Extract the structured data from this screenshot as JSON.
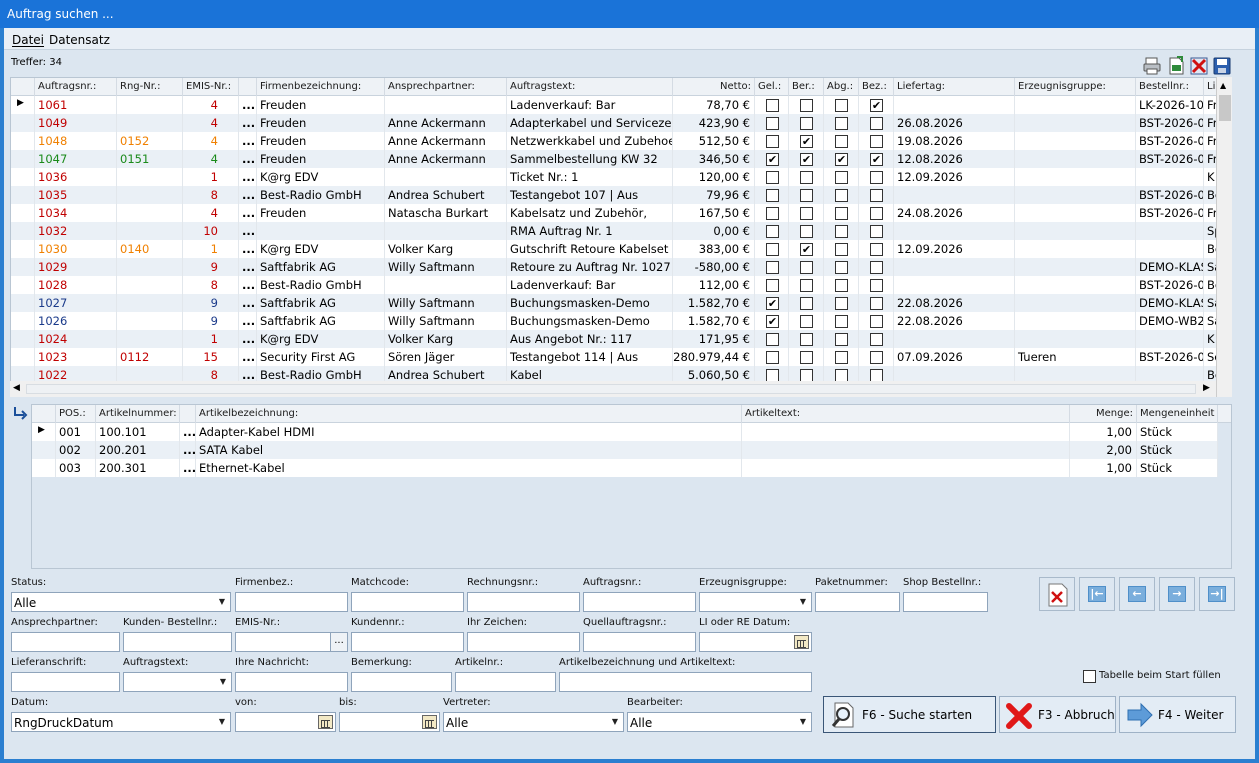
{
  "window": {
    "title": "Auftrag suchen ..."
  },
  "menu": [
    "Datei",
    "Datensatz"
  ],
  "hits": "Treffer: 34",
  "toolbar_icons": [
    "print-icon",
    "export-excel-icon",
    "delete-icon",
    "save-icon"
  ],
  "orders": {
    "headers": [
      "Auftragsnr.:",
      "Rng-Nr.:",
      "EMIS-Nr.:",
      "",
      "Firmenbezeichnung:",
      "Ansprechpartner:",
      "Auftragstext:",
      "Netto:",
      "Gel.:",
      "Ber.:",
      "Abg.:",
      "Bez.:",
      "Liefertag:",
      "Erzeugnisgruppe:",
      "Bestellnr.:",
      "Li"
    ],
    "rows": [
      {
        "nr": "1061",
        "rng": "",
        "emis": "4",
        "dots": "...",
        "firma": "Freuden",
        "ansp": "",
        "text": "Ladenverkauf: Bar",
        "netto": "78,70 €",
        "gel": false,
        "ber": false,
        "abg": false,
        "bez": true,
        "liefertag": "",
        "gruppe": "",
        "bestell": "LK-2026-10",
        "li": "Fr",
        "color": "#c00000",
        "current": true
      },
      {
        "nr": "1049",
        "rng": "",
        "emis": "4",
        "dots": "...",
        "firma": "Freuden",
        "ansp": "Anne Ackermann",
        "text": "Adapterkabel und Servicezeit",
        "netto": "423,90 €",
        "gel": false,
        "ber": false,
        "abg": false,
        "bez": false,
        "liefertag": "26.08.2026",
        "gruppe": "",
        "bestell": "BST-2026-0",
        "li": "Fr",
        "color": "#c00000"
      },
      {
        "nr": "1048",
        "rng": "0152",
        "emis": "4",
        "dots": "...",
        "firma": "Freuden",
        "ansp": "Anne Ackermann",
        "text": "Netzwerkkabel und Zubehoer",
        "netto": "512,50 €",
        "gel": false,
        "ber": true,
        "abg": false,
        "bez": false,
        "liefertag": "19.08.2026",
        "gruppe": "",
        "bestell": "BST-2026-0",
        "li": "Fr",
        "color": "#f08000"
      },
      {
        "nr": "1047",
        "rng": "0151",
        "emis": "4",
        "dots": "...",
        "firma": "Freuden",
        "ansp": "Anne Ackermann",
        "text": "Sammelbestellung KW 32",
        "netto": "346,50 €",
        "gel": true,
        "ber": true,
        "abg": true,
        "bez": true,
        "liefertag": "12.08.2026",
        "gruppe": "",
        "bestell": "BST-2026-0",
        "li": "Fr",
        "color": "#1a8a1a"
      },
      {
        "nr": "1036",
        "rng": "",
        "emis": "1",
        "dots": "...",
        "firma": "K@rg EDV",
        "ansp": "",
        "text": "Ticket Nr.: 1",
        "netto": "120,00 €",
        "gel": false,
        "ber": false,
        "abg": false,
        "bez": false,
        "liefertag": "12.09.2026",
        "gruppe": "",
        "bestell": "",
        "li": "K",
        "color": "#c00000"
      },
      {
        "nr": "1035",
        "rng": "",
        "emis": "8",
        "dots": "...",
        "firma": "Best-Radio GmbH",
        "ansp": "Andrea Schubert",
        "text": "Testangebot 107 | Aus",
        "netto": "79,96 €",
        "gel": false,
        "ber": false,
        "abg": false,
        "bez": false,
        "liefertag": "",
        "gruppe": "",
        "bestell": "BST-2026-0",
        "li": "Be",
        "color": "#c00000"
      },
      {
        "nr": "1034",
        "rng": "",
        "emis": "4",
        "dots": "...",
        "firma": "Freuden",
        "ansp": "Natascha Burkart",
        "text": "Kabelsatz und Zubehör,",
        "netto": "167,50 €",
        "gel": false,
        "ber": false,
        "abg": false,
        "bez": false,
        "liefertag": "24.08.2026",
        "gruppe": "",
        "bestell": "BST-2026-0",
        "li": "Fr",
        "color": "#c00000"
      },
      {
        "nr": "1032",
        "rng": "",
        "emis": "10",
        "dots": "...",
        "firma": "",
        "ansp": "",
        "text": "RMA Auftrag Nr. 1",
        "netto": "0,00 €",
        "gel": false,
        "ber": false,
        "abg": false,
        "bez": false,
        "liefertag": "",
        "gruppe": "",
        "bestell": "",
        "li": "Sp",
        "color": "#c00000"
      },
      {
        "nr": "1030",
        "rng": "0140",
        "emis": "1",
        "dots": "...",
        "firma": "K@rg EDV",
        "ansp": "Volker Karg",
        "text": "Gutschrift Retoure Kabelset",
        "netto": "383,00 €",
        "gel": false,
        "ber": true,
        "abg": false,
        "bez": false,
        "liefertag": "12.09.2026",
        "gruppe": "",
        "bestell": "",
        "li": "Be",
        "color": "#f08000"
      },
      {
        "nr": "1029",
        "rng": "",
        "emis": "9",
        "dots": "...",
        "firma": "Saftfabrik AG",
        "ansp": "Willy Saftmann",
        "text": "Retoure zu Auftrag Nr. 1027",
        "netto": "-580,00 €",
        "gel": false,
        "ber": false,
        "abg": false,
        "bez": false,
        "liefertag": "",
        "gruppe": "",
        "bestell": "DEMO-KLAS",
        "li": "Sa",
        "color": "#c00000"
      },
      {
        "nr": "1028",
        "rng": "",
        "emis": "8",
        "dots": "...",
        "firma": "Best-Radio GmbH",
        "ansp": "",
        "text": "Ladenverkauf: Bar",
        "netto": "112,00 €",
        "gel": false,
        "ber": false,
        "abg": false,
        "bez": false,
        "liefertag": "",
        "gruppe": "",
        "bestell": "BST-2026-0",
        "li": "Be",
        "color": "#c00000"
      },
      {
        "nr": "1027",
        "rng": "",
        "emis": "9",
        "dots": "...",
        "firma": "Saftfabrik AG",
        "ansp": "Willy Saftmann",
        "text": "Buchungsmasken-Demo",
        "netto": "1.582,70 €",
        "gel": true,
        "ber": false,
        "abg": false,
        "bez": false,
        "liefertag": "22.08.2026",
        "gruppe": "",
        "bestell": "DEMO-KLAS",
        "li": "Sa",
        "color": "#1a3a8a"
      },
      {
        "nr": "1026",
        "rng": "",
        "emis": "9",
        "dots": "...",
        "firma": "Saftfabrik AG",
        "ansp": "Willy Saftmann",
        "text": "Buchungsmasken-Demo",
        "netto": "1.582,70 €",
        "gel": true,
        "ber": false,
        "abg": false,
        "bez": false,
        "liefertag": "22.08.2026",
        "gruppe": "",
        "bestell": "DEMO-WB2",
        "li": "Sa",
        "color": "#1a3a8a"
      },
      {
        "nr": "1024",
        "rng": "",
        "emis": "1",
        "dots": "...",
        "firma": "K@rg EDV",
        "ansp": "Volker Karg",
        "text": "Aus Angebot Nr.: 117",
        "netto": "171,95 €",
        "gel": false,
        "ber": false,
        "abg": false,
        "bez": false,
        "liefertag": "",
        "gruppe": "",
        "bestell": "",
        "li": "K",
        "color": "#c00000"
      },
      {
        "nr": "1023",
        "rng": "0112",
        "emis": "15",
        "dots": "...",
        "firma": "Security First AG",
        "ansp": "Sören Jäger",
        "text": "Testangebot 114 | Aus",
        "netto": "280.979,44 €",
        "gel": false,
        "ber": false,
        "abg": false,
        "bez": false,
        "liefertag": "07.09.2026",
        "gruppe": "Tueren",
        "bestell": "BST-2026-0",
        "li": "Se",
        "color": "#c00000"
      },
      {
        "nr": "1022",
        "rng": "",
        "emis": "8",
        "dots": "...",
        "firma": "Best-Radio GmbH",
        "ansp": "Andrea Schubert",
        "text": "Kabel",
        "netto": "5.060,50 €",
        "gel": false,
        "ber": false,
        "abg": false,
        "bez": false,
        "liefertag": "",
        "gruppe": "",
        "bestell": "",
        "li": "Be",
        "color": "#c00000"
      }
    ]
  },
  "positions": {
    "headers": [
      "POS.:",
      "Artikelnummer:",
      "",
      "Artikelbezeichnung:",
      "Artikeltext:",
      "Menge:",
      "Mengeneinheit"
    ],
    "rows": [
      {
        "pos": "001",
        "art": "100.101",
        "dots": "...",
        "bez": "Adapter-Kabel HDMI",
        "text": "",
        "menge": "1,00",
        "einheit": "Stück",
        "current": true
      },
      {
        "pos": "002",
        "art": "200.201",
        "dots": "...",
        "bez": "SATA Kabel",
        "text": "",
        "menge": "2,00",
        "einheit": "Stück"
      },
      {
        "pos": "003",
        "art": "200.301",
        "dots": "...",
        "bez": "Ethernet-Kabel",
        "text": "",
        "menge": "1,00",
        "einheit": "Stück"
      }
    ]
  },
  "filters": {
    "status_label": "Status:",
    "status_value": "Alle",
    "firmenbez_label": "Firmenbez.:",
    "matchcode_label": "Matchcode:",
    "rechnungsnr_label": "Rechnungsnr.:",
    "auftragsnr_label": "Auftragsnr.:",
    "erzeugnisgruppe_label": "Erzeugnisgruppe:",
    "paketnummer_label": "Paketnummer:",
    "shop_label": "Shop Bestellnr.:",
    "ansprechpartner_label": "Ansprechpartner:",
    "kundenbestell_label": "Kunden- Bestellnr.:",
    "emis_label": "EMIS-Nr.:",
    "emis_button": "...",
    "kundennr_label": "Kundennr.:",
    "ihrzeichen_label": "Ihr Zeichen:",
    "quellauftrag_label": "Quellauftragsnr.:",
    "lidatum_label": "LI oder RE Datum:",
    "lieferanschrift_label": "Lieferanschrift:",
    "auftragstext_label": "Auftragstext:",
    "ihrenachricht_label": "Ihre Nachricht:",
    "bemerkung_label": "Bemerkung:",
    "artikelnr_label": "Artikelnr.:",
    "artikelbez_label": "Artikelbezeichnung und Artikeltext:",
    "datum_label": "Datum:",
    "datum_value": "RngDruckDatum",
    "von_label": "von:",
    "bis_label": "bis:",
    "vertreter_label": "Vertreter:",
    "vertreter_value": "Alle",
    "bearbeiter_label": "Bearbeiter:",
    "bearbeiter_value": "Alle",
    "fill_on_start_label": "Tabelle beim Start füllen"
  },
  "buttons": {
    "search": "F6 - Suche starten",
    "cancel": "F3 - Abbruch",
    "next": "F4 - Weiter"
  },
  "nav_icons": [
    "clear-filter-icon",
    "first-record-icon",
    "previous-record-icon",
    "next-record-icon",
    "last-record-icon"
  ]
}
